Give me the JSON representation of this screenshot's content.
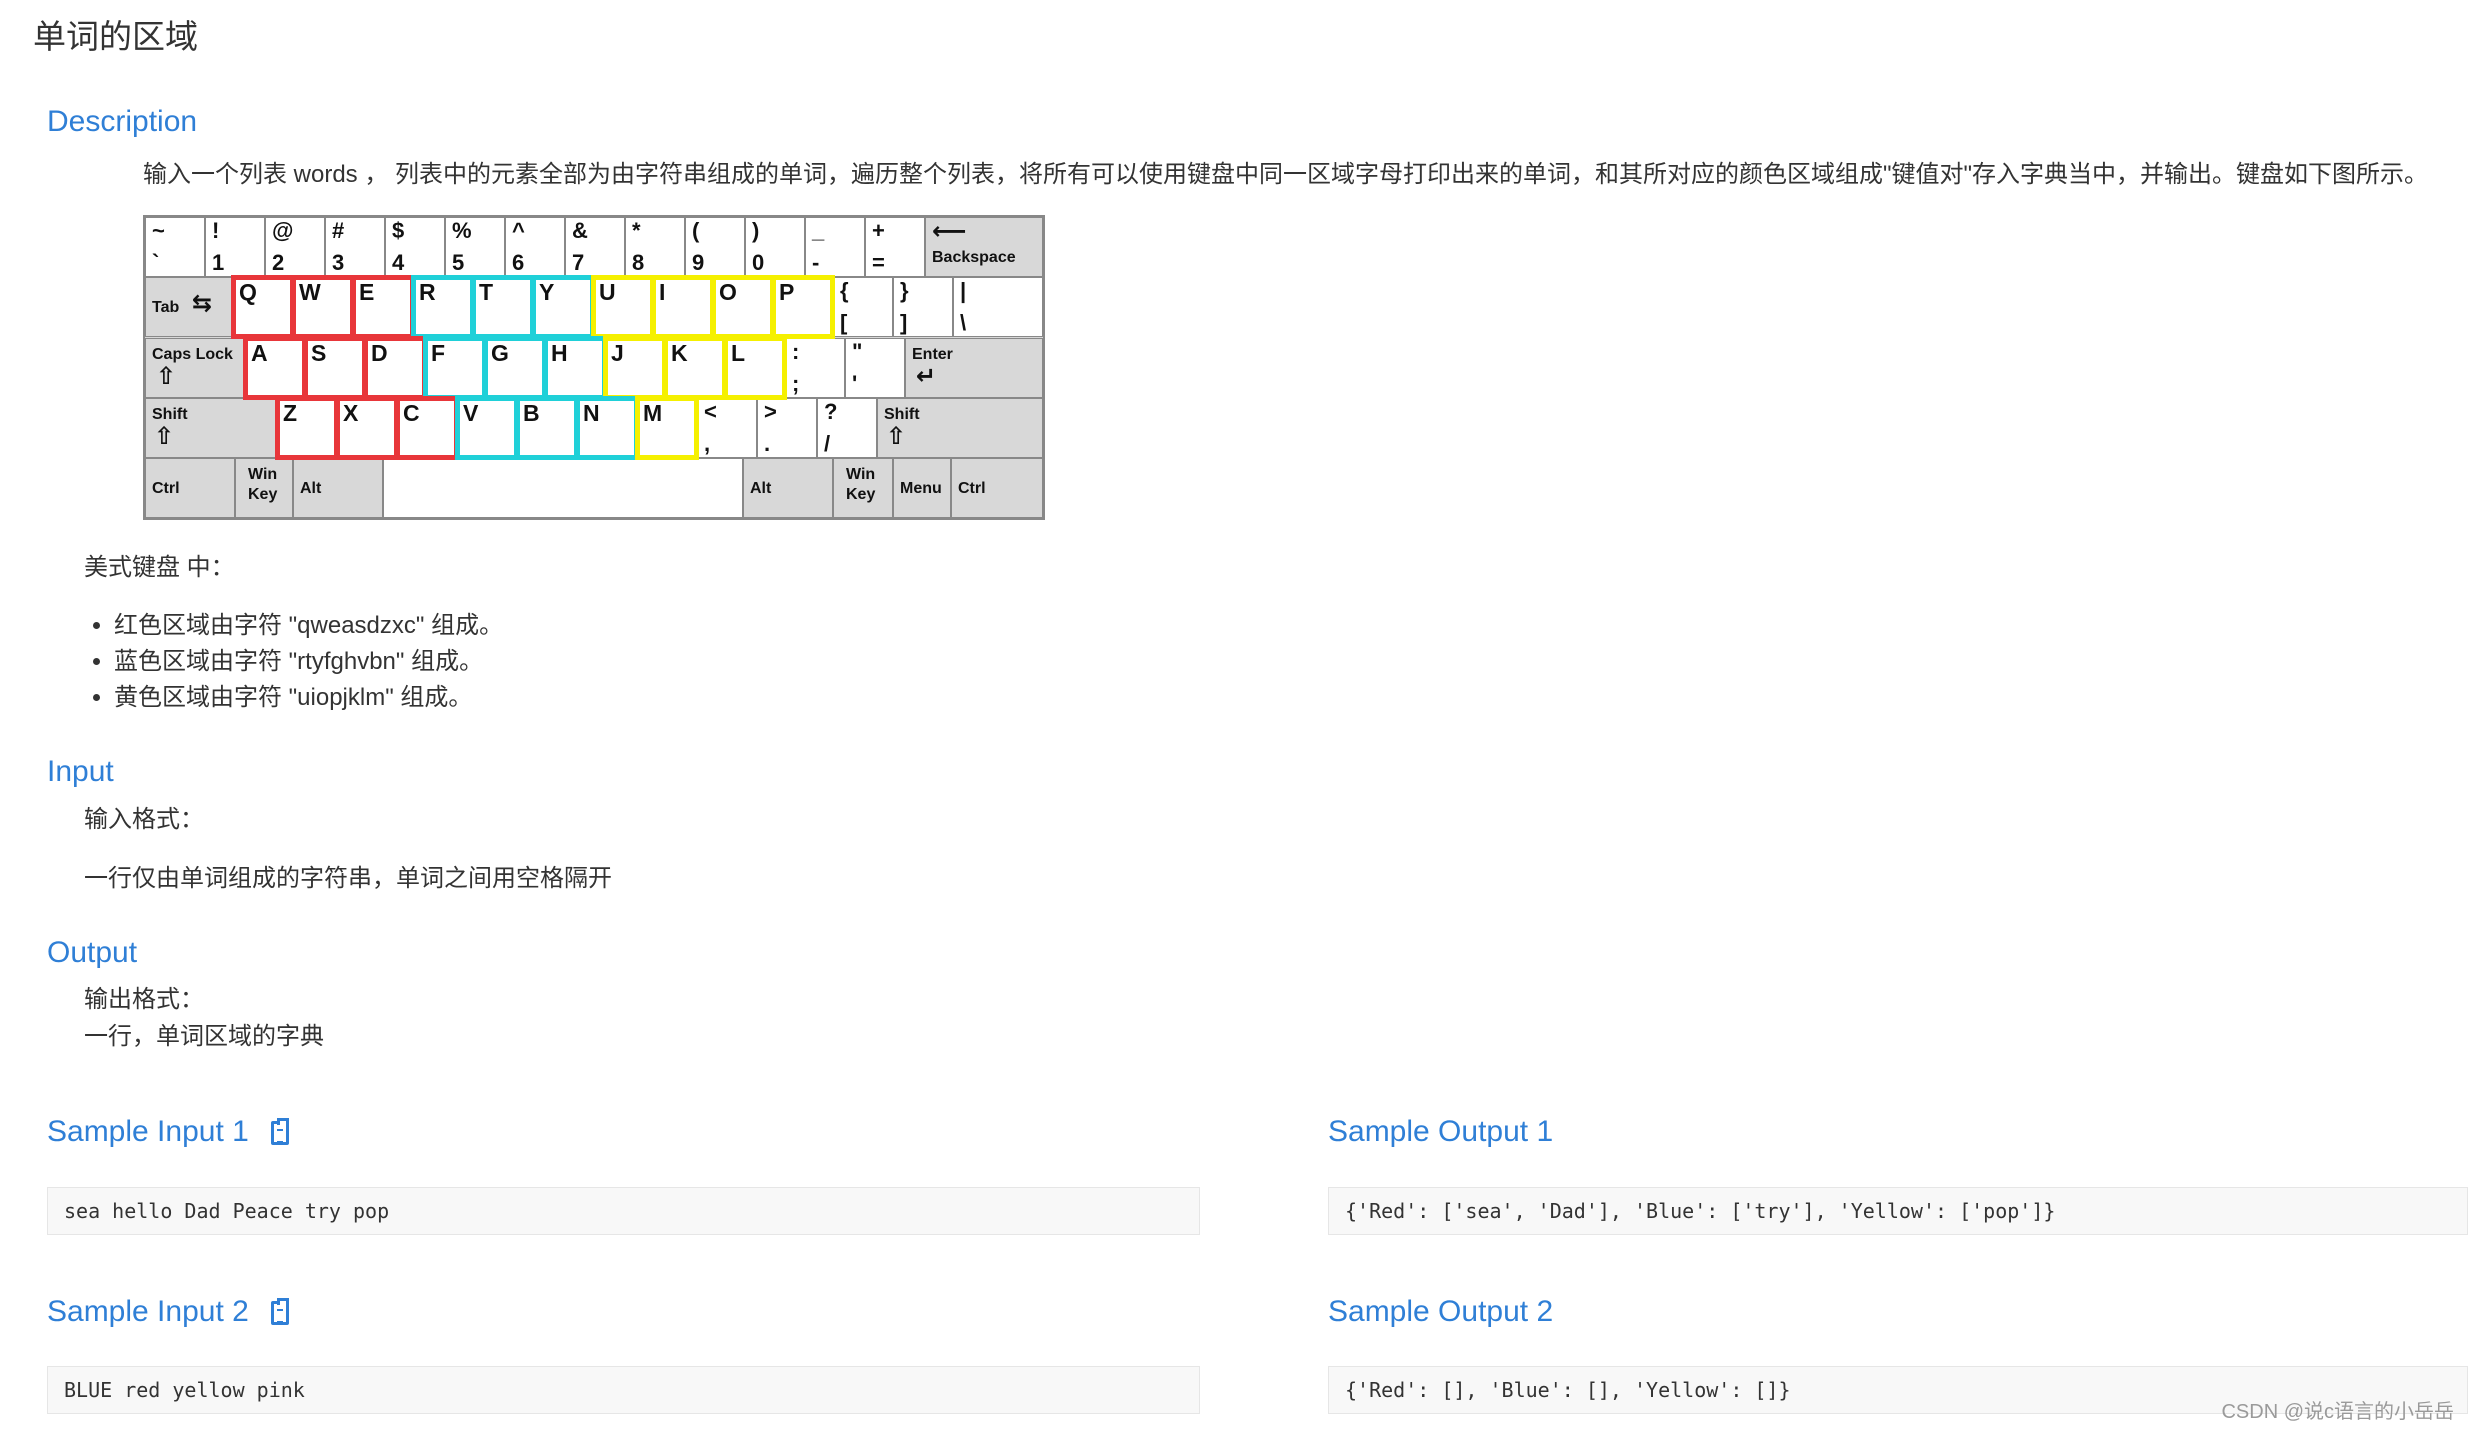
{
  "page_title": "单词的区域",
  "description": {
    "title": "Description",
    "text": "输入一个列表 words ， 列表中的元素全部为由字符串组成的单词，遍历整个列表，将所有可以使用键盘中同一区域字母打印出来的单词，和其所对应的颜色区域组成\"键值对\"存入字典当中，并输出。键盘如下图所示。",
    "keyboard_caption": "美式键盘 中：",
    "rules": [
      "红色区域由字符 \"qweasdzxc\" 组成。",
      "蓝色区域由字符 \"rtyfghvbn\" 组成。",
      "黄色区域由字符 \"uiopjklm\" 组成。"
    ]
  },
  "keyboard": {
    "number_row": [
      [
        "~",
        "`"
      ],
      [
        "!",
        "1"
      ],
      [
        "@",
        "2"
      ],
      [
        "#",
        "3"
      ],
      [
        "$",
        "4"
      ],
      [
        "%",
        "5"
      ],
      [
        "^",
        "6"
      ],
      [
        "&",
        "7"
      ],
      [
        "*",
        "8"
      ],
      [
        "(",
        "9"
      ],
      [
        ")",
        "0"
      ],
      [
        "_",
        "-"
      ],
      [
        "+",
        "="
      ]
    ],
    "backspace": "Backspace",
    "tab": "Tab",
    "row_q": [
      "Q",
      "W",
      "E",
      "R",
      "T",
      "Y",
      "U",
      "I",
      "O",
      "P"
    ],
    "brackets": [
      [
        "{",
        "["
      ],
      [
        "}",
        "]"
      ],
      [
        "|",
        "\\"
      ]
    ],
    "caps_lock": "Caps Lock",
    "row_a": [
      "A",
      "S",
      "D",
      "F",
      "G",
      "H",
      "J",
      "K",
      "L"
    ],
    "semis": [
      [
        ":",
        ";"
      ],
      [
        "\"",
        "'"
      ]
    ],
    "enter": "Enter",
    "shift": "Shift",
    "row_z": [
      "Z",
      "X",
      "C",
      "V",
      "B",
      "N",
      "M"
    ],
    "punct": [
      [
        "<",
        ","
      ],
      [
        ">",
        "."
      ],
      [
        "?",
        "/"
      ]
    ],
    "ctrl": "Ctrl",
    "win": "Win",
    "key_word": "Key",
    "alt": "Alt",
    "menu": "Menu",
    "colors": {
      "red": "#e8363a",
      "cyan": "#1fd0d8",
      "yellow": "#f5f000"
    }
  },
  "input": {
    "title": "Input",
    "format_label": "输入格式：",
    "format_text": "一行仅由单词组成的字符串，单词之间用空格隔开"
  },
  "output": {
    "title": "Output",
    "format_label": "输出格式：",
    "format_text": "一行，单词区域的字典"
  },
  "samples": [
    {
      "input_title": "Sample Input 1",
      "input": "sea hello Dad Peace try pop",
      "output_title": "Sample Output 1",
      "output": "{'Red': ['sea', 'Dad'], 'Blue': ['try'], 'Yellow': ['pop']}"
    },
    {
      "input_title": "Sample Input 2",
      "input": "BLUE red yellow pink",
      "output_title": "Sample Output 2",
      "output": "{'Red': [], 'Blue': [], 'Yellow': []}"
    }
  ],
  "watermark": "CSDN @说c语言的小岳岳",
  "accent_color": "#2f7fd6"
}
